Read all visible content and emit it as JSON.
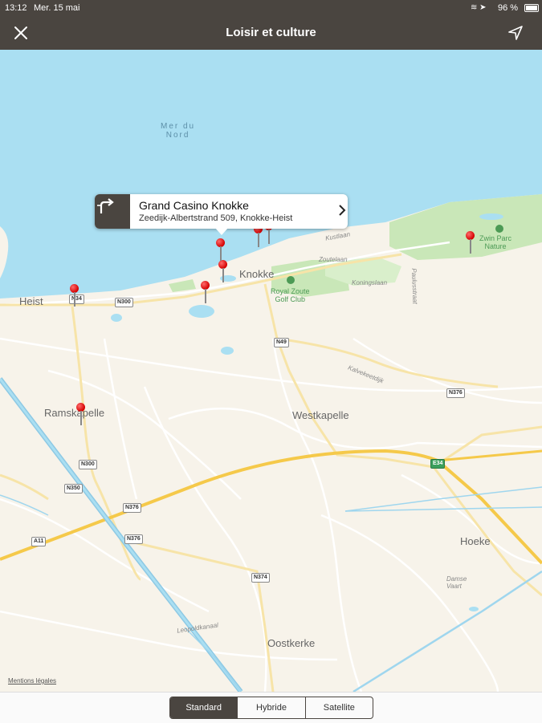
{
  "status": {
    "time": "13:12",
    "date": "Mer. 15 mai",
    "battery": "96 %"
  },
  "nav": {
    "title": "Loisir et culture",
    "close_icon": "close-icon",
    "location_icon": "location-arrow-icon"
  },
  "map": {
    "sea_label": "Mer du\nNord",
    "towns": {
      "heist": "Heist",
      "knokke": "Knokke",
      "ramskapelle": "Ramskapelle",
      "westkapelle": "Westkapelle",
      "hoeke": "Hoeke",
      "oostkerke": "Oostkerke"
    },
    "parks": {
      "golf": "Royal Zoute\nGolf Club",
      "zwin": "Zwin Parc\nNature"
    },
    "small_labels": {
      "zoutelaan": "Zoutelaan",
      "koningslaan": "Koningslaan",
      "kalvekeetdijk": "Kalvekeetdijk",
      "canal": "Leopoldkanaal",
      "damse_vaart": "Damse\nVaart",
      "kustlaan": "Kustlaan",
      "paulusstraat": "Paulusstraat"
    },
    "roads": {
      "n34": "N34",
      "n300_a": "N300",
      "n49": "N49",
      "n376_a": "N376",
      "n300_b": "N300",
      "n350": "N350",
      "n376_b": "N376",
      "n376_c": "N376",
      "a11": "A11",
      "n374": "N374",
      "e34": "E34"
    },
    "legal": "Mentions légales"
  },
  "callout": {
    "title": "Grand Casino Knokke",
    "address": "Zeedijk-Albertstrand 509, Knokke-Heist",
    "icon": "directions-icon"
  },
  "segments": {
    "standard": "Standard",
    "hybrid": "Hybride",
    "satellite": "Satellite",
    "selected": "Standard"
  },
  "colors": {
    "bar": "#4a4540",
    "water": "#aadff2",
    "land": "#f7f3ea",
    "park": "#c9e7b8",
    "pin": "#e00000",
    "road_major": "#f5c94a"
  }
}
